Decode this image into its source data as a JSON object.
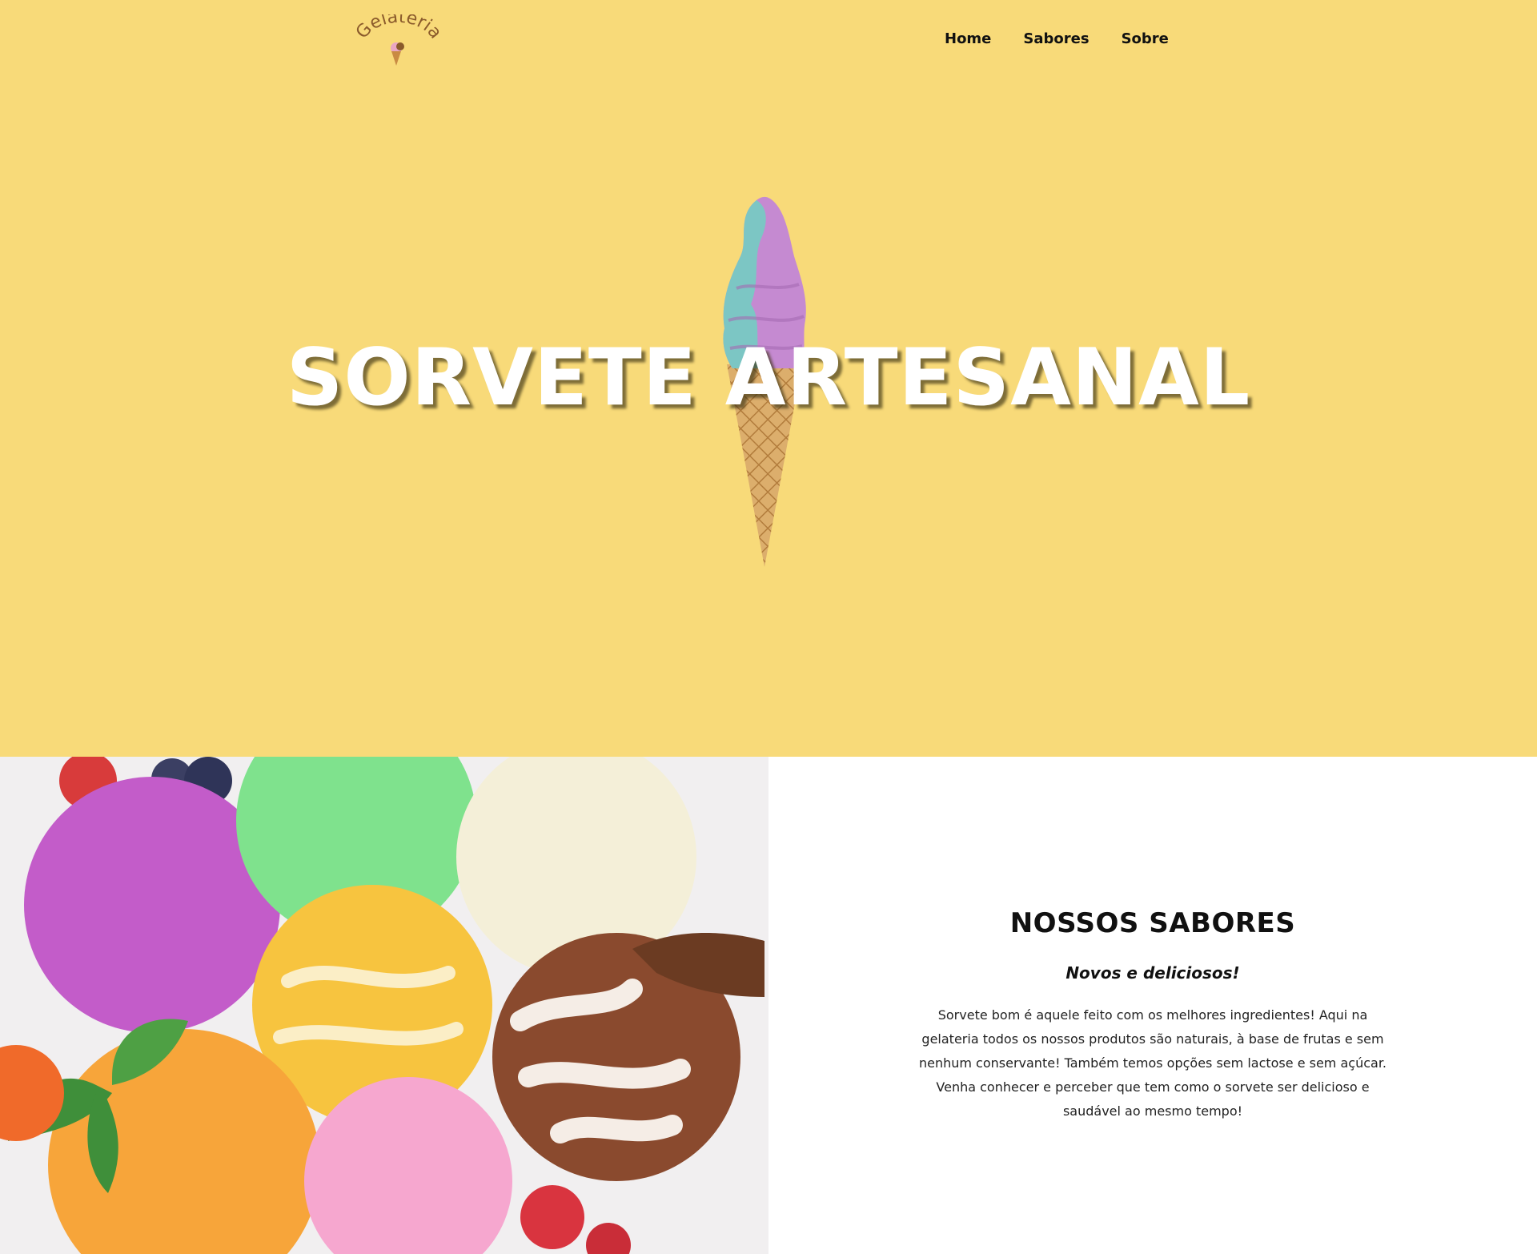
{
  "header": {
    "logo_text": "Gelateria",
    "nav": [
      {
        "label": "Home"
      },
      {
        "label": "Sabores"
      },
      {
        "label": "Sobre"
      }
    ]
  },
  "hero": {
    "title": "SORVETE ARTESANAL",
    "background": "#f8da79",
    "image_icon": "ice-cream-cone"
  },
  "flavors": {
    "title": "NOSSOS SABORES",
    "subtitle": "Novos e deliciosos!",
    "body": "Sorvete bom é aquele feito com os melhores ingredientes! Aqui na gelateria todos os nossos produtos são naturais, à base de frutas e sem nenhum conservante! Também temos opções sem lactose e sem açúcar. Venha conhecer e perceber que tem como o sorvete ser delicioso e saudável ao mesmo tempo!",
    "image": "ice-cream-scoops-photo"
  }
}
